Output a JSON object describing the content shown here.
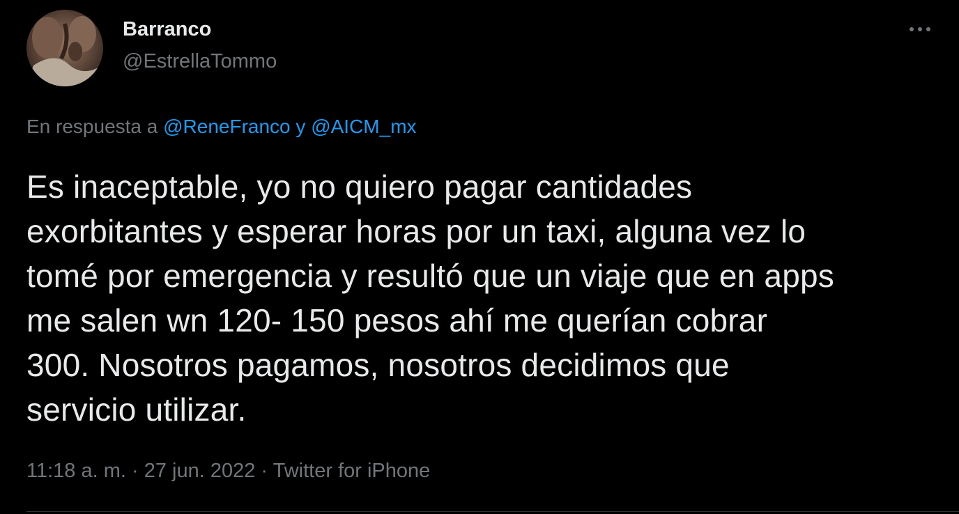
{
  "user": {
    "display_name": "Barranco",
    "handle": "@EstrellaTommo",
    "avatar_icon": "profile-photo-avatar"
  },
  "more_icon": "more-horizontal-icon",
  "reply": {
    "prefix": "En respuesta a ",
    "mention_1": "@ReneFranco",
    "joiner": " y ",
    "mention_2": "@AICM_mx"
  },
  "tweet": {
    "lines": [
      "Es inaceptable, yo no quiero pagar cantidades",
      "exorbitantes y esperar horas por un taxi, alguna vez lo",
      "tomé por emergencia y resultó que un viaje que en apps",
      "me salen wn 120- 150 pesos ahí me querían cobrar",
      "300. Nosotros pagamos, nosotros decidimos que",
      "servicio utilizar."
    ]
  },
  "meta": {
    "time": "11:18 a. m.",
    "sep_1": " · ",
    "date": "27 jun. 2022",
    "sep_2": " · ",
    "source": "Twitter for iPhone"
  },
  "colors": {
    "background": "#000000",
    "text_primary": "#e7e9ea",
    "text_secondary": "#71767b",
    "accent": "#1d9bf0"
  }
}
